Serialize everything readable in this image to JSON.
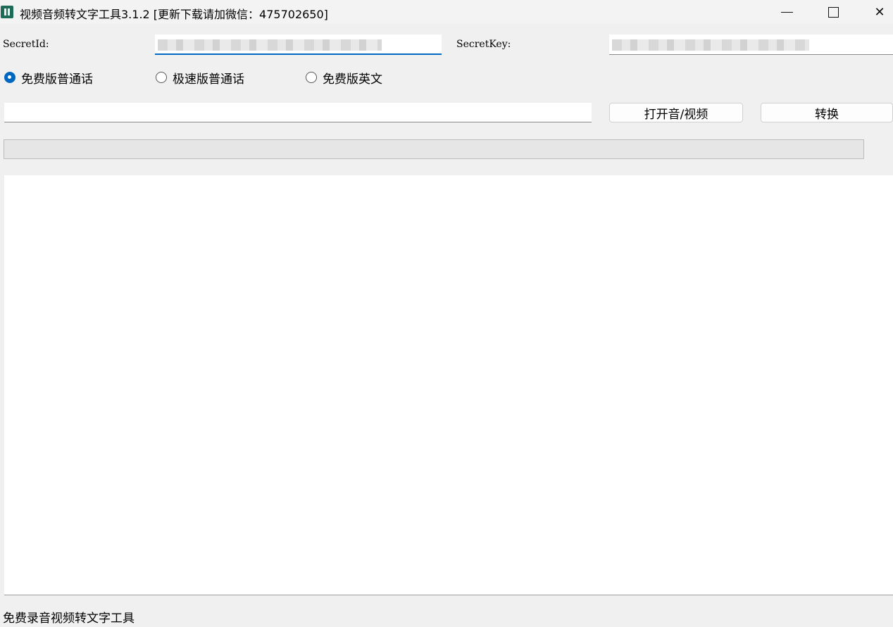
{
  "window": {
    "title": "视频音频转文字工具3.1.2 [更新下载请加微信：475702650]",
    "controls": [
      "minimize-icon",
      "maximize-icon",
      "close-icon"
    ],
    "close_glyph": "✕"
  },
  "credentials": {
    "secret_id_label": "SecretId:",
    "secret_key_label": "SecretKey:",
    "secret_id_value": "",
    "secret_key_value": ""
  },
  "modes": [
    {
      "label": "免费版普通话",
      "selected": true
    },
    {
      "label": "极速版普通话",
      "selected": false
    },
    {
      "label": "免费版英文",
      "selected": false
    }
  ],
  "file": {
    "path_value": "",
    "open_button_label": "打开音/视频",
    "convert_button_label": "转换"
  },
  "progress": {
    "value": 0
  },
  "output": {
    "text": ""
  },
  "status_bar": {
    "text": "免费录音视频转文字工具"
  },
  "colors": {
    "accent": "#0067c0",
    "background": "#f0f0f0",
    "progress_fill": "#06b025"
  }
}
